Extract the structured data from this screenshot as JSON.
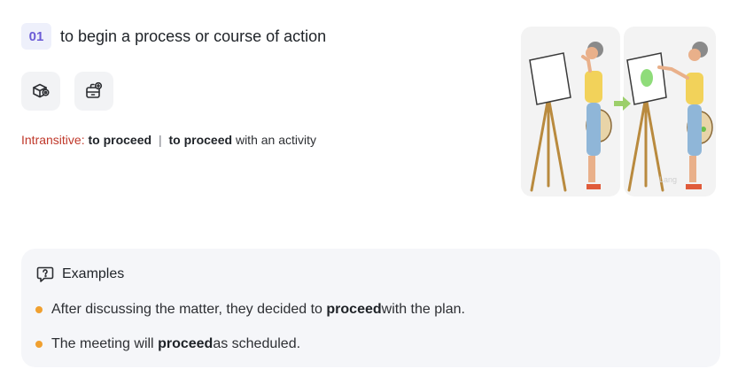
{
  "definition": {
    "number": "01",
    "text": "to begin a process or course of action"
  },
  "actions": [
    {
      "icon": "cube-settings-icon"
    },
    {
      "icon": "briefcase-add-icon"
    }
  ],
  "grammar": {
    "label": "Intransitive:",
    "form1": "to proceed",
    "separator": "|",
    "form2": "to proceed",
    "form2_suffix": " with an activity"
  },
  "illustration": {
    "watermark": "Lang"
  },
  "examples": {
    "title": "Examples",
    "items": [
      {
        "before": "After discussing the matter, they decided to ",
        "word": "proceed",
        "after": " with the plan."
      },
      {
        "before": "The meeting will ",
        "word": "proceed",
        "after": " as scheduled."
      }
    ]
  },
  "colors": {
    "badge_bg": "#eef0fb",
    "badge_text": "#6b5bd6",
    "grammar_label": "#c0392b",
    "bullet": "#f0a030",
    "examples_bg": "#f5f6f9"
  }
}
